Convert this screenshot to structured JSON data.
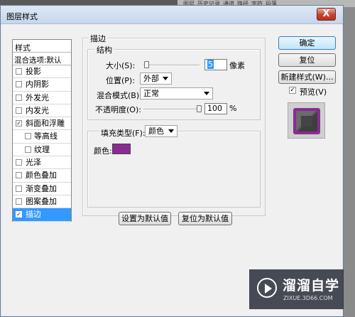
{
  "background": {
    "tabs": [
      "图层",
      "历史记录",
      "通道",
      "路径",
      "字符",
      "段落"
    ]
  },
  "dialog": {
    "title": "图层样式",
    "close_label": "X"
  },
  "sidebar": {
    "header": "样式",
    "blend_options": "混合选项:默认",
    "items": [
      {
        "label": "投影",
        "checked": false
      },
      {
        "label": "内阴影",
        "checked": false
      },
      {
        "label": "外发光",
        "checked": false
      },
      {
        "label": "内发光",
        "checked": false
      },
      {
        "label": "斜面和浮雕",
        "checked": true
      },
      {
        "label": "等高线",
        "checked": false,
        "sub": true
      },
      {
        "label": "纹理",
        "checked": false,
        "sub": true
      },
      {
        "label": "光泽",
        "checked": false
      },
      {
        "label": "颜色叠加",
        "checked": false
      },
      {
        "label": "渐变叠加",
        "checked": false
      },
      {
        "label": "图案叠加",
        "checked": false
      },
      {
        "label": "描边",
        "checked": true,
        "active": true
      }
    ]
  },
  "stroke": {
    "group_title": "描边",
    "structure_title": "结构",
    "size_label": "大小(S):",
    "size_value": "5",
    "size_unit": "像素",
    "position_label": "位置(P):",
    "position_value": "外部",
    "blend_label": "混合模式(B):",
    "blend_value": "正常",
    "opacity_label": "不透明度(O):",
    "opacity_value": "100",
    "opacity_unit": "%",
    "fill_type_label": "填充类型(F):",
    "fill_type_value": "颜色",
    "color_label": "颜色:",
    "color_hex": "#8b2a95",
    "set_default_button": "设置为默认值",
    "reset_default_button": "复位为默认值"
  },
  "right_panel": {
    "ok_button": "确定",
    "reset_button": "复位",
    "new_style_button": "新建样式(W)...",
    "preview_label": "预览(V)",
    "preview_checked": true
  },
  "watermark": {
    "title": "溜溜自学",
    "url": "ZIXUE.3D66.COM"
  },
  "colors": {
    "accent": "#3399ff",
    "stroke_color": "#8b2a95"
  }
}
